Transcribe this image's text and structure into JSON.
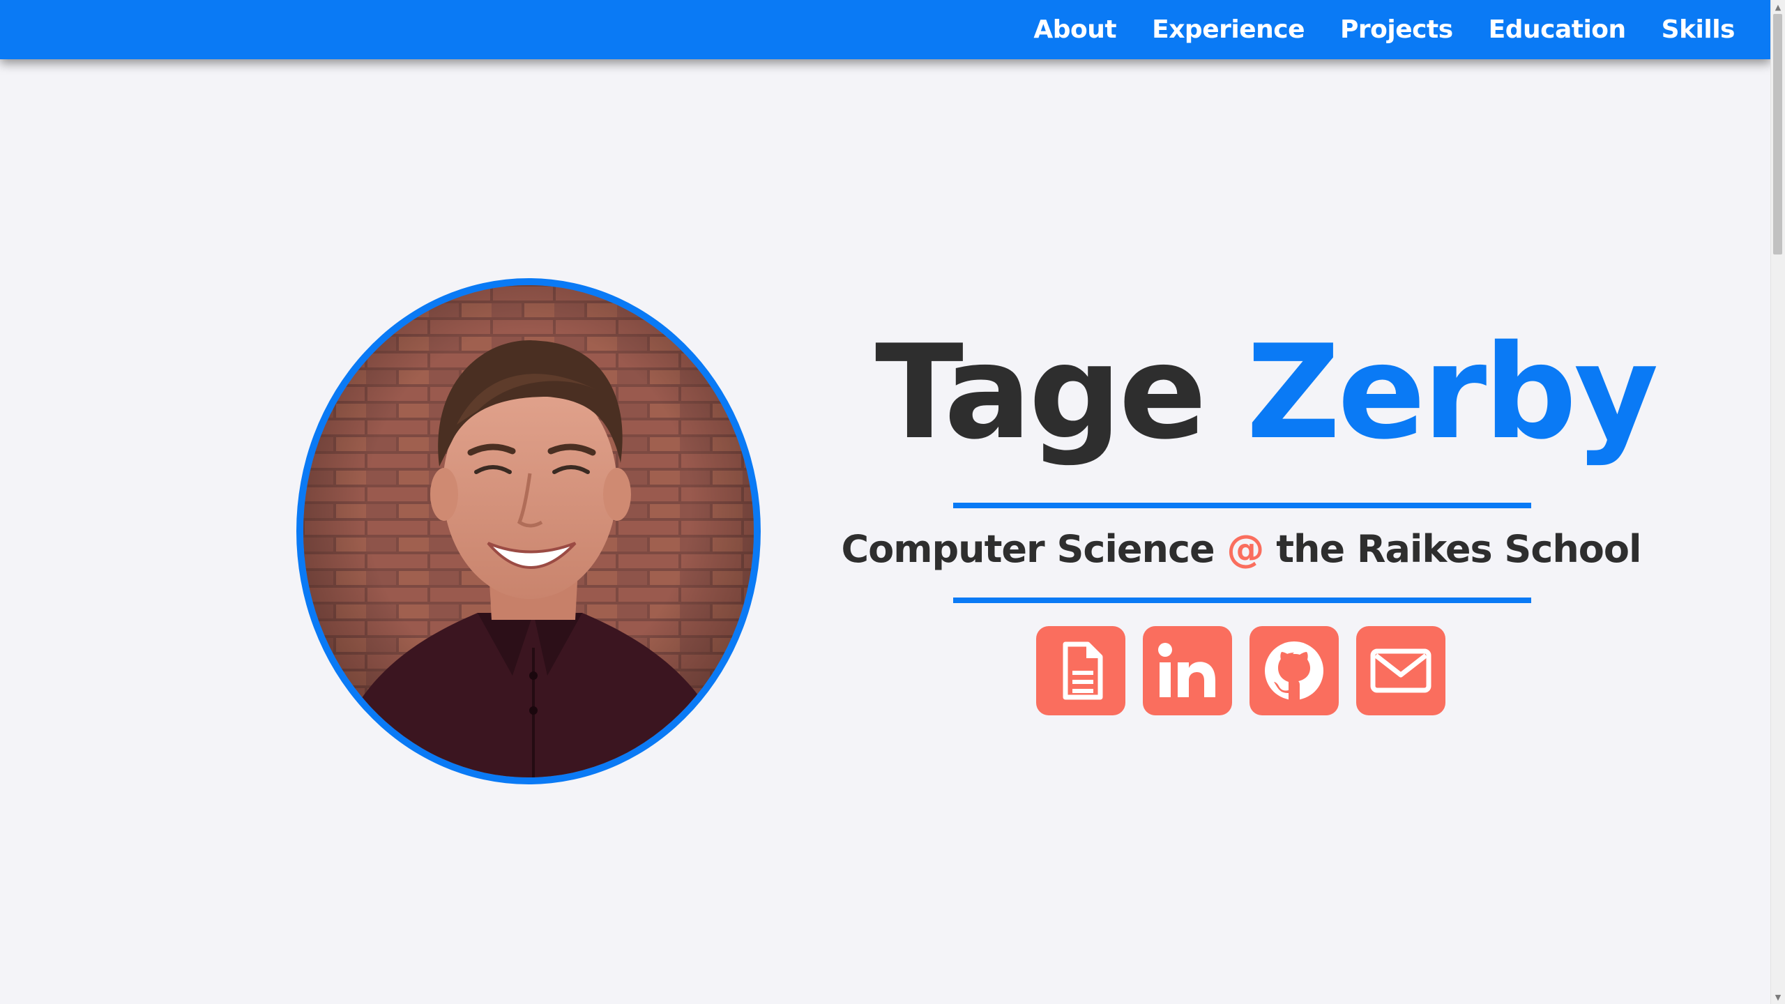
{
  "nav": {
    "items": [
      {
        "label": "About"
      },
      {
        "label": "Experience"
      },
      {
        "label": "Projects"
      },
      {
        "label": "Education"
      },
      {
        "label": "Skills"
      }
    ]
  },
  "hero": {
    "name_first": "Tage",
    "name_last": "Zerby",
    "subtitle_before": "Computer Science ",
    "subtitle_at": "@",
    "subtitle_after": " the Raikes School",
    "social_links": [
      {
        "icon": "resume-document-icon"
      },
      {
        "icon": "linkedin-icon"
      },
      {
        "icon": "github-icon"
      },
      {
        "icon": "email-envelope-icon"
      }
    ]
  },
  "colors": {
    "accent_blue": "#0a7af5",
    "accent_coral": "#fa6e5e",
    "text_dark": "#2e2e2e",
    "background": "#f4f4f8"
  }
}
